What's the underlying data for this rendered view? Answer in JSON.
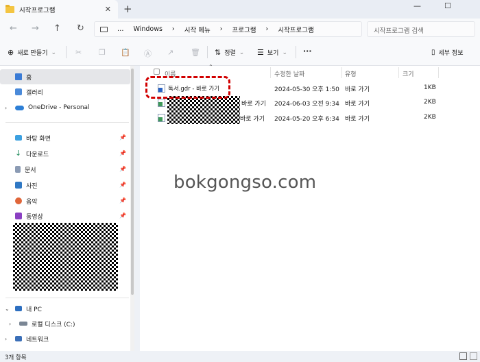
{
  "tab": {
    "title": "시작프로그램",
    "close": "✕",
    "new_tab": "+"
  },
  "window_controls": {
    "minimize": "—",
    "maximize": "☐",
    "close": "✕"
  },
  "nav": {
    "back": "←",
    "forward": "→",
    "up": "↑",
    "refresh": "↻",
    "more": "…"
  },
  "breadcrumb": [
    "Windows",
    "시작 메뉴",
    "프로그램",
    "시작프로그램"
  ],
  "search": {
    "placeholder": "시작프로그램 검색"
  },
  "toolbar": {
    "new_label": "새로 만들기",
    "sort_label": "정렬",
    "view_label": "보기",
    "more_label": "···",
    "details_label": "세부 정보"
  },
  "sidebar": {
    "items": [
      {
        "label": "홈",
        "icon": "home-icon",
        "selected": true
      },
      {
        "label": "갤러리",
        "icon": "gallery-icon"
      },
      {
        "label": "OneDrive - Personal",
        "icon": "cloud-icon",
        "expandable": true
      }
    ],
    "pinned": [
      {
        "label": "바탕 화면",
        "icon": "desktop-icon"
      },
      {
        "label": "다운로드",
        "icon": "download-icon"
      },
      {
        "label": "문서",
        "icon": "document-icon"
      },
      {
        "label": "사진",
        "icon": "pictures-icon"
      },
      {
        "label": "음악",
        "icon": "music-icon"
      },
      {
        "label": "동영상",
        "icon": "video-icon"
      }
    ],
    "devices": [
      {
        "label": "내 PC",
        "icon": "pc-icon",
        "expanded": true
      },
      {
        "label": "로컬 디스크 (C:)",
        "icon": "drive-icon"
      },
      {
        "label": "네트워크",
        "icon": "network-icon"
      }
    ]
  },
  "columns": {
    "name": "이름",
    "modified": "수정한 날짜",
    "type": "유형",
    "size": "크기"
  },
  "files": [
    {
      "name": "독서.gdr - 바로 가기",
      "modified": "2024-05-30 오후 1:50",
      "type": "바로 가기",
      "size": "1KB"
    },
    {
      "name": "바로 가기",
      "modified": "2024-06-03 오전 9:34",
      "type": "바로 가기",
      "size": "2KB"
    },
    {
      "name": "바로 가기",
      "modified": "2024-05-20 오후 6:34",
      "type": "바로 가기",
      "size": "2KB"
    }
  ],
  "watermark": "bokgongso.com",
  "status": {
    "count": "3개 항목"
  },
  "colors": {
    "highlight": "#d10000",
    "selected": "#e5e6e9"
  }
}
